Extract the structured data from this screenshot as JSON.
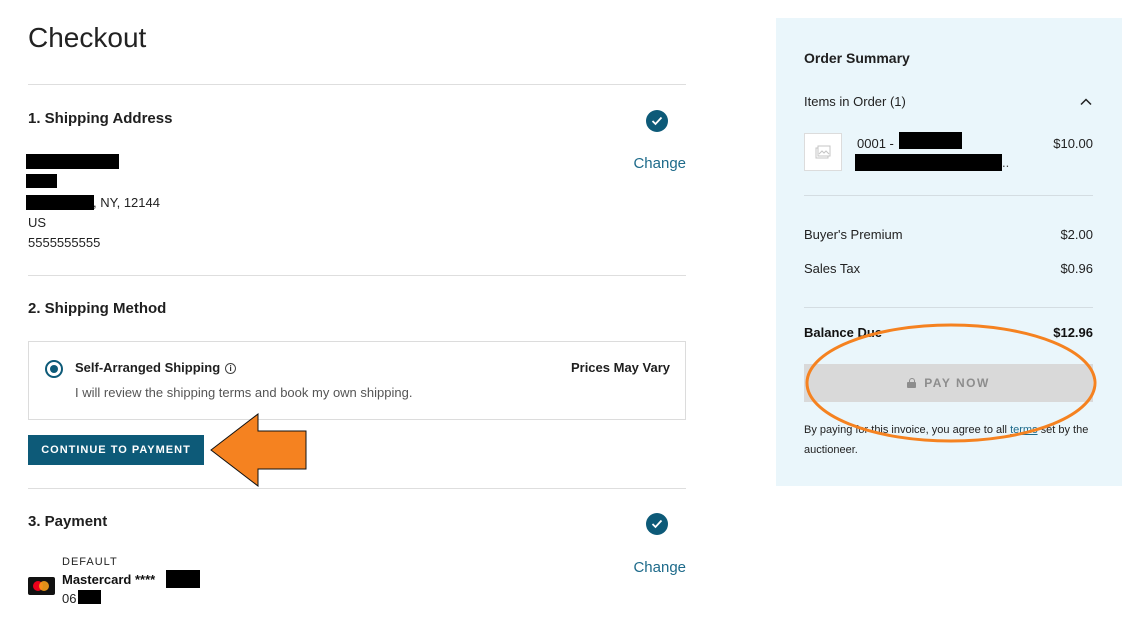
{
  "page": {
    "title": "Checkout"
  },
  "shipping_address": {
    "title": "1. Shipping Address",
    "change_label": "Change",
    "city_line": ", NY, 12144",
    "country": "US",
    "phone": "5555555555"
  },
  "shipping_method": {
    "title": "2. Shipping Method",
    "option_name": "Self-Arranged Shipping",
    "option_info_glyph": "i",
    "option_desc": "I will review the shipping terms and book my own shipping.",
    "option_price": "Prices May Vary",
    "continue_label": "CONTINUE TO PAYMENT"
  },
  "payment": {
    "title": "3. Payment",
    "change_label": "Change",
    "default_label": "DEFAULT",
    "card_name": "Mastercard ****",
    "exp_prefix": "06"
  },
  "summary": {
    "title": "Order Summary",
    "items_toggle": "Items in Order (1)",
    "item_lot": "0001 -",
    "item_price": "$10.00",
    "item_ellipsis": "..",
    "buyers_premium_label": "Buyer's Premium",
    "buyers_premium_value": "$2.00",
    "sales_tax_label": "Sales Tax",
    "sales_tax_value": "$0.96",
    "balance_label": "Balance Due",
    "balance_value": "$12.96",
    "pay_now_label": "PAY NOW",
    "terms_before": "By paying for this invoice, you agree to all ",
    "terms_link": "terms",
    "terms_after": " set by the auctioneer."
  },
  "colors": {
    "accent": "#0d5a78",
    "summary_bg": "#eaf6fb",
    "annotation_orange": "#f58220"
  },
  "icons": [
    "check-circle-icon",
    "info-icon",
    "chevron-up-icon",
    "image-placeholder-icon",
    "lock-icon",
    "mastercard-icon",
    "arrow-annotation",
    "oval-annotation"
  ]
}
